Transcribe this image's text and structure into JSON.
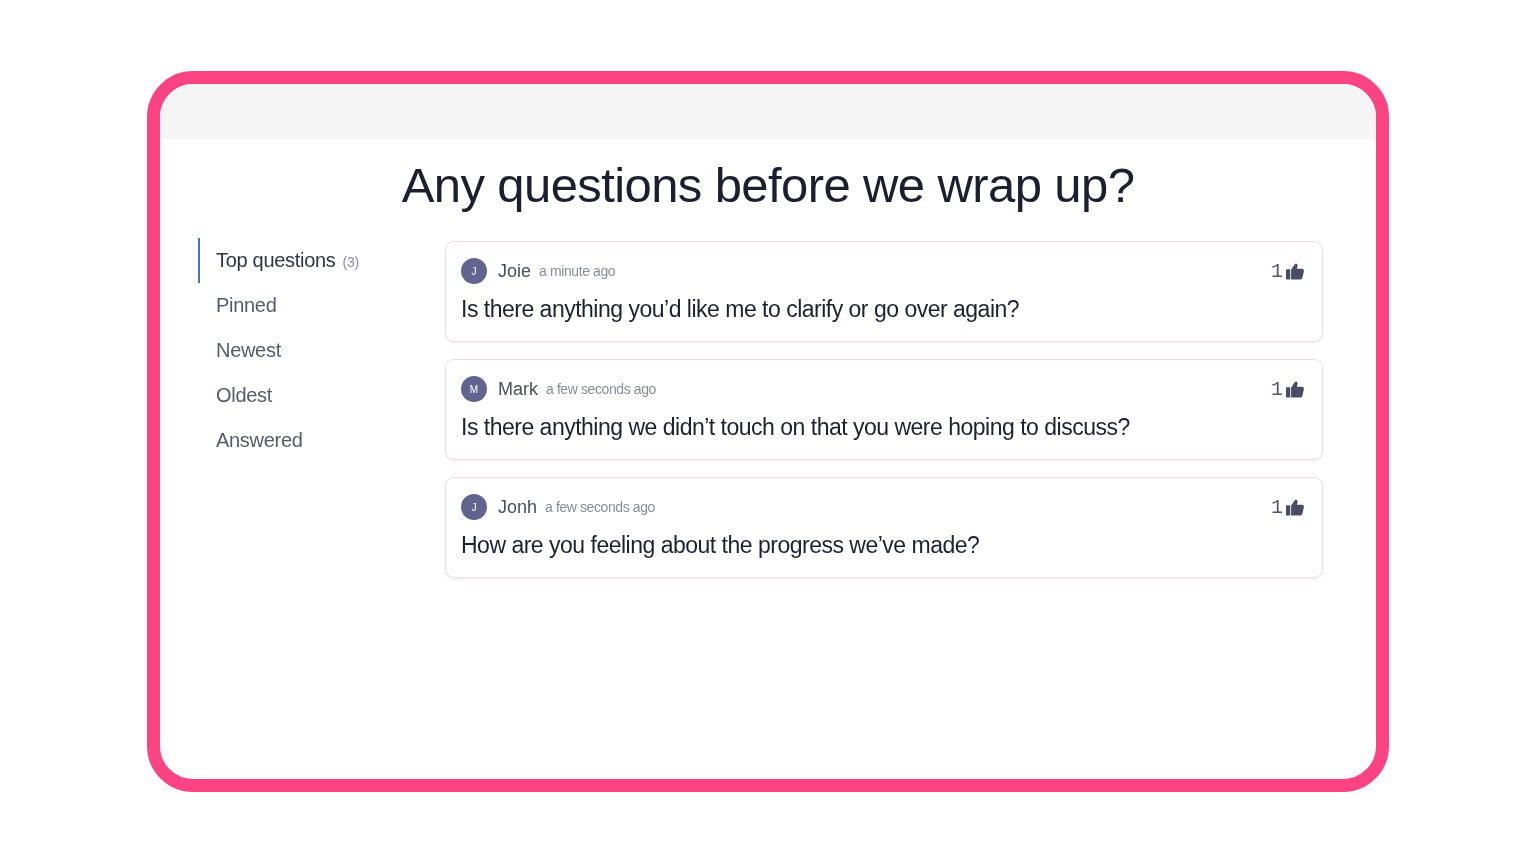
{
  "title": "Any questions before we wrap up?",
  "tabs": [
    {
      "label": "Top questions",
      "count": "(3)",
      "selected": true
    },
    {
      "label": "Pinned",
      "selected": false
    },
    {
      "label": "Newest",
      "selected": false
    },
    {
      "label": "Oldest",
      "selected": false
    },
    {
      "label": "Answered",
      "selected": false
    }
  ],
  "questions": [
    {
      "avatar": "J",
      "author": "Joie",
      "time": "a minute ago",
      "text": "Is there anything you’d like me to clarify or go over again?",
      "likes": "1"
    },
    {
      "avatar": "M",
      "author": "Mark",
      "time": "a few seconds ago",
      "text": "Is there anything we didn’t touch on that you were hoping to discuss?",
      "likes": "1"
    },
    {
      "avatar": "J",
      "author": "Jonh",
      "time": "a few seconds ago",
      "text": "How are you feeling about the progress we’ve made?",
      "likes": "1"
    }
  ]
}
